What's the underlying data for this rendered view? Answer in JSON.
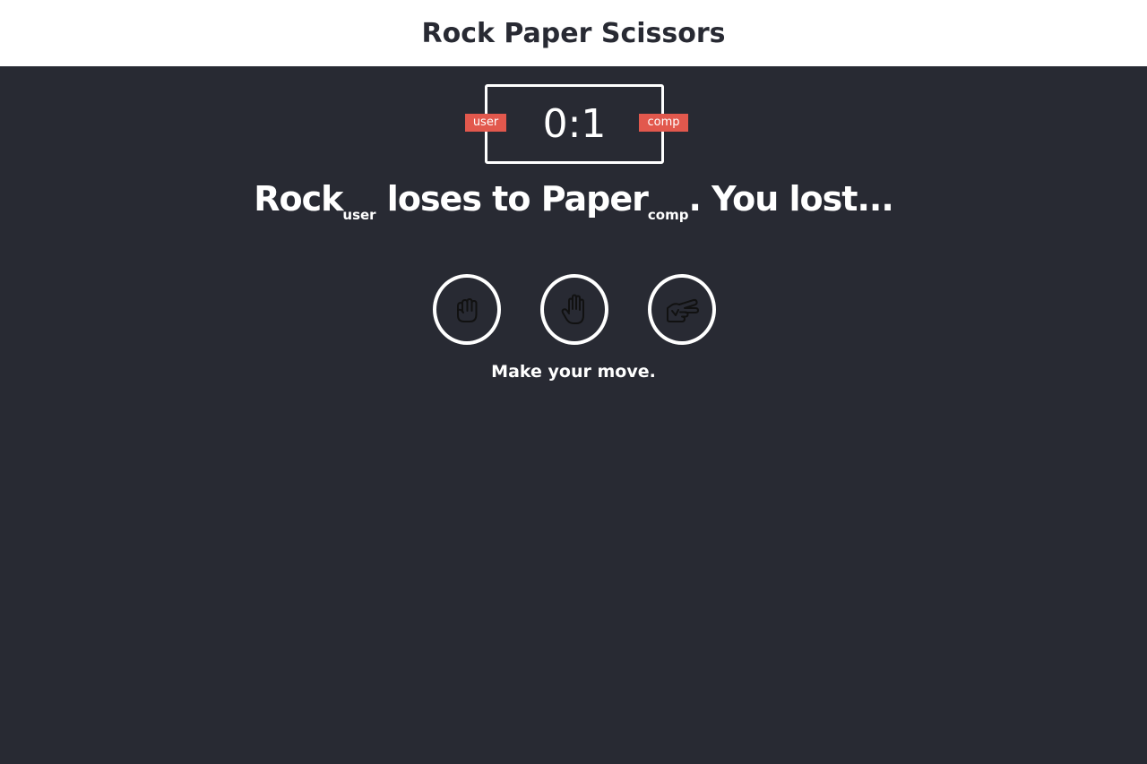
{
  "header": {
    "title": "Rock Paper Scissors"
  },
  "scoreboard": {
    "score": "0:1",
    "user_badge": "user",
    "comp_badge": "comp",
    "badge_color": "#e2584d"
  },
  "result": {
    "user_choice": "Rock",
    "user_tag": "user",
    "middle": " loses to ",
    "comp_choice": "Paper",
    "comp_tag": "comp",
    "ending": ". You lost..."
  },
  "choices": [
    {
      "name": "rock",
      "icon": "fist-icon"
    },
    {
      "name": "paper",
      "icon": "open-hand-icon"
    },
    {
      "name": "scissors",
      "icon": "peace-hand-icon"
    }
  ],
  "action_message": "Make your move.",
  "colors": {
    "background": "#282a33",
    "header_bg": "#ffffff",
    "accent": "#e2584d"
  }
}
